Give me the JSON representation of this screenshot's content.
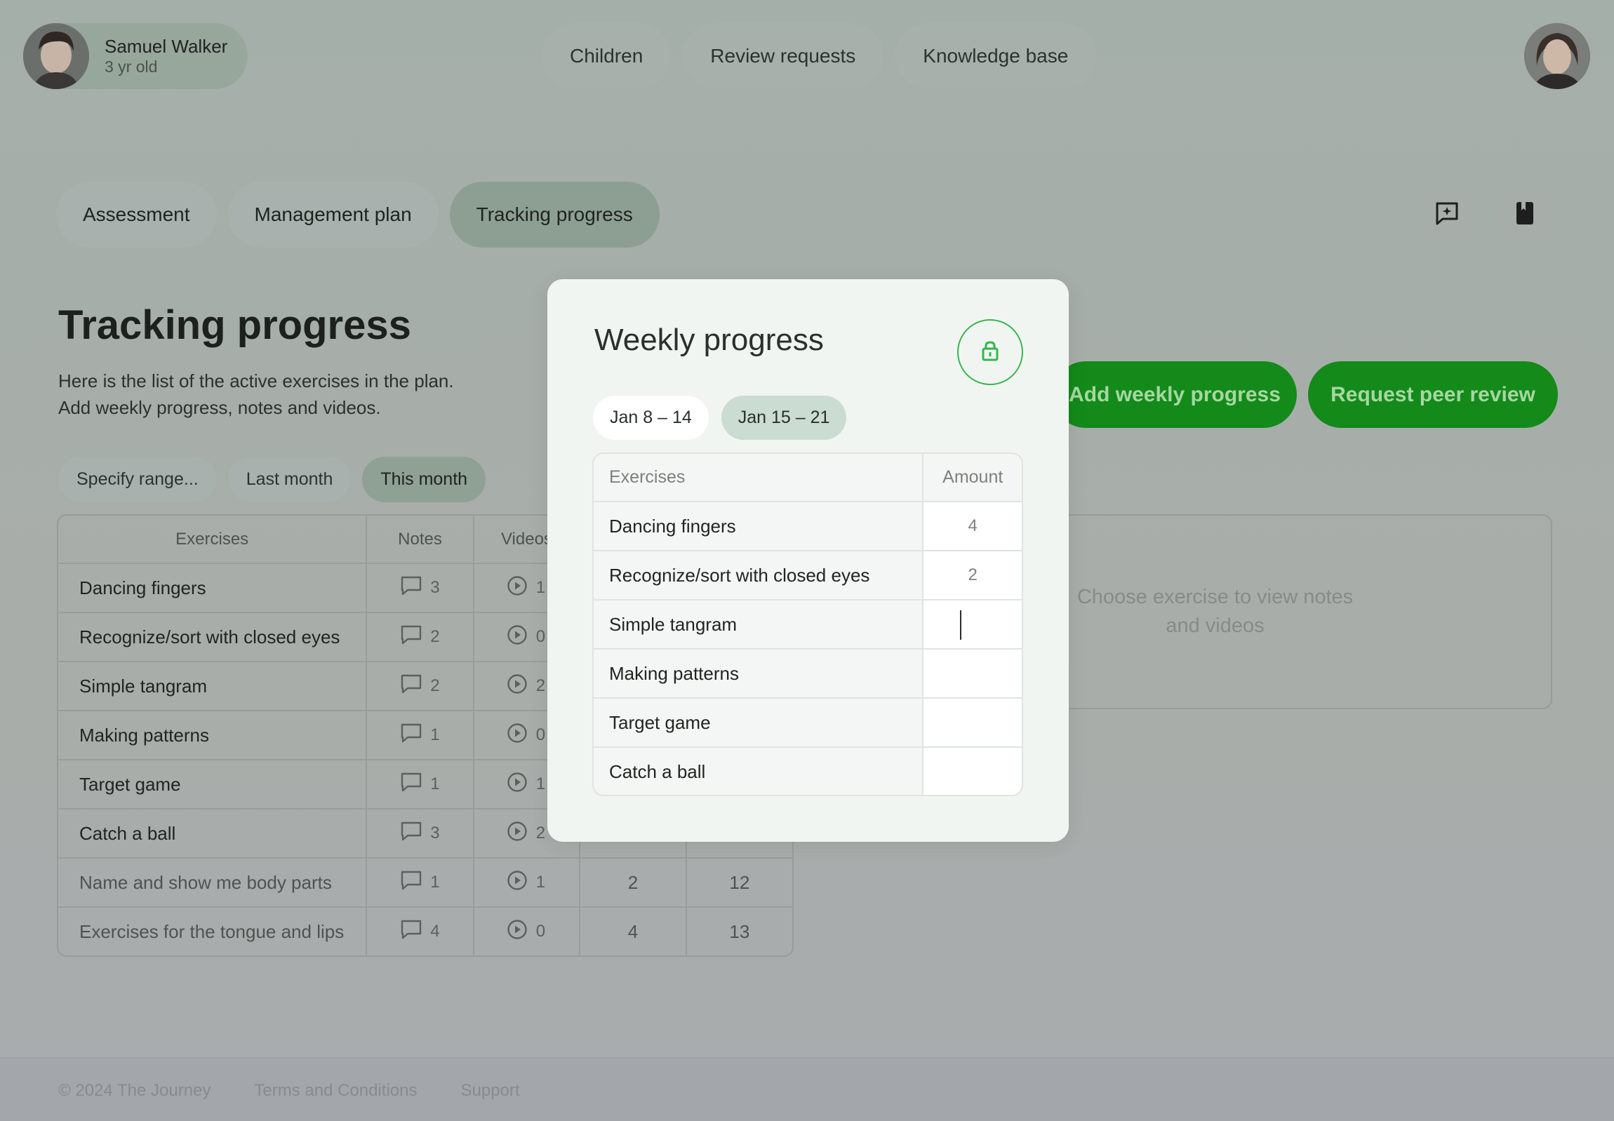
{
  "profile": {
    "name": "Samuel Walker",
    "age": "3 yr old"
  },
  "topnav": [
    "Children",
    "Review requests",
    "Knowledge base"
  ],
  "tabs": [
    "Assessment",
    "Management plan",
    "Tracking progress"
  ],
  "page": {
    "title": "Tracking progress",
    "desc_line1": "Here is the list of the active exercises in the plan.",
    "desc_line2": "Add weekly progress, notes and videos."
  },
  "ranges": [
    "Specify range...",
    "Last month",
    "This month"
  ],
  "buttons": {
    "add": "Add weekly progress",
    "review": "Request peer review"
  },
  "table": {
    "headers": [
      "Exercises",
      "Notes",
      "Videos"
    ],
    "rows": [
      {
        "name": "Dancing fingers",
        "notes": "3",
        "videos": "1",
        "c4": "",
        "c5": ""
      },
      {
        "name": "Recognize/sort with closed eyes",
        "notes": "2",
        "videos": "0",
        "c4": "",
        "c5": ""
      },
      {
        "name": "Simple tangram",
        "notes": "2",
        "videos": "2",
        "c4": "",
        "c5": ""
      },
      {
        "name": "Making patterns",
        "notes": "1",
        "videos": "0",
        "c4": "",
        "c5": ""
      },
      {
        "name": "Target game",
        "notes": "1",
        "videos": "1",
        "c4": "",
        "c5": ""
      },
      {
        "name": "Catch a ball",
        "notes": "3",
        "videos": "2",
        "c4": "",
        "c5": ""
      },
      {
        "name": "Name and show me body parts",
        "notes": "1",
        "videos": "1",
        "c4": "2",
        "c5": "12"
      },
      {
        "name": "Exercises for the tongue and lips",
        "notes": "4",
        "videos": "0",
        "c4": "4",
        "c5": "13"
      }
    ]
  },
  "notes_panel": {
    "line1": "Choose exercise to view notes",
    "line2": "and videos"
  },
  "footer": {
    "copyright": "© 2024 The Journey",
    "terms": "Terms and Conditions",
    "support": "Support"
  },
  "modal": {
    "title": "Weekly progress",
    "weeks": [
      "Jan 8 – 14",
      "Jan 15 – 21"
    ],
    "headers": {
      "exercises": "Exercises",
      "amount": "Amount"
    },
    "rows": [
      {
        "name": "Dancing fingers",
        "amount": "4"
      },
      {
        "name": "Recognize/sort with closed eyes",
        "amount": "2"
      },
      {
        "name": "Simple tangram",
        "amount": ""
      },
      {
        "name": "Making patterns",
        "amount": ""
      },
      {
        "name": "Target game",
        "amount": ""
      },
      {
        "name": "Catch a ball",
        "amount": ""
      }
    ]
  },
  "colors": {
    "accent_green": "#138a19",
    "lock_green": "#35b64d"
  }
}
